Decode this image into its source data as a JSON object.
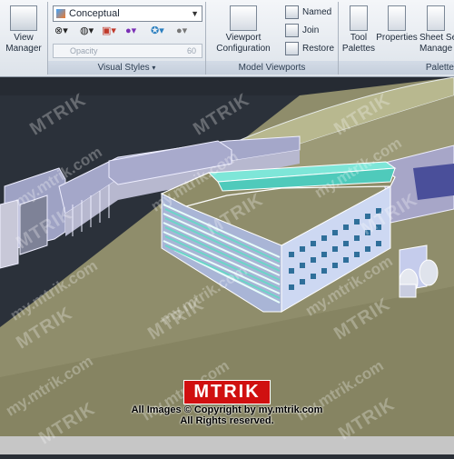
{
  "ribbon": {
    "view_manager": {
      "line1": "View",
      "line2": "Manager"
    },
    "visual_styles": {
      "current_style": "Conceptual",
      "opacity_label": "Opacity",
      "opacity_value": "60",
      "panel_title": "Visual Styles"
    },
    "model_viewports": {
      "config_line1": "Viewport",
      "config_line2": "Configuration",
      "named": "Named",
      "join": "Join",
      "restore": "Restore",
      "panel_title": "Model Viewports"
    },
    "palettes": {
      "tool_line1": "Tool",
      "tool_line2": "Palettes",
      "properties": "Properties",
      "sheet_line1": "Sheet Se",
      "sheet_line2": "Manage",
      "panel_title": "Palette"
    }
  },
  "watermark": {
    "brand": "MTRIK",
    "site": "my.mtrik.com"
  },
  "credit": {
    "logo": "MTRIK",
    "line1": "All Images © Copyright by my.mtrik.com",
    "line2": "All Rights reserved."
  }
}
